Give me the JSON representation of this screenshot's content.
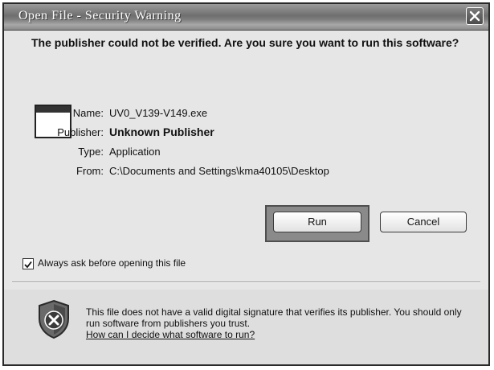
{
  "window": {
    "title": "Open File - Security Warning"
  },
  "question": "The publisher could not be verified.  Are you sure you want to run this software?",
  "file_info": {
    "name_label": "Name:",
    "name_value": "UV0_V139-V149.exe",
    "publisher_label": "Publisher:",
    "publisher_value": "Unknown Publisher",
    "type_label": "Type:",
    "type_value": "Application",
    "from_label": "From:",
    "from_value": "C:\\Documents and Settings\\kma40105\\Desktop"
  },
  "buttons": {
    "run_label": "Run",
    "cancel_label": "Cancel"
  },
  "checkbox": {
    "label": "Always ask before opening this file",
    "checked": true
  },
  "warning": {
    "text": "This file does not have a valid digital signature that verifies its publisher.  You should only run software from publishers you trust.",
    "help_link": "How can I decide what software to run?"
  },
  "icons": {
    "app": "application-icon",
    "shield": "security-shield-icon",
    "close": "close-icon",
    "check": "checkmark-icon"
  }
}
